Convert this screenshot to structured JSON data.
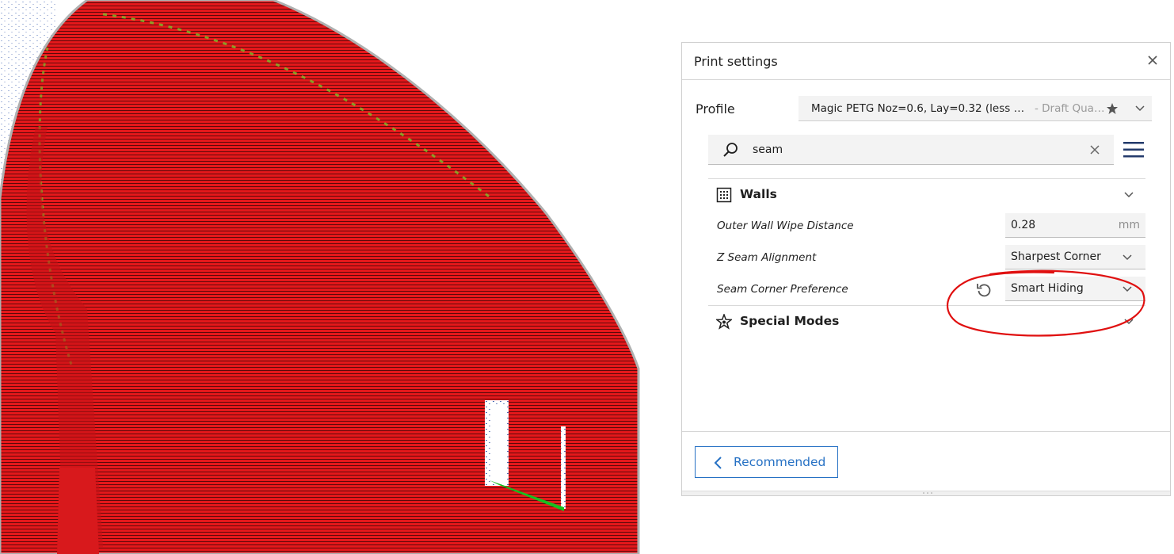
{
  "viewport": {
    "colors": {
      "model": "#e5181b",
      "layer_line": "#1a0000",
      "skin": "#7ec02a",
      "travel": "#4d6fb8",
      "background": "#ffffff"
    }
  },
  "print_settings": {
    "title": "Print settings",
    "profile": {
      "label": "Profile",
      "name": "Magic PETG Noz=0.6, Lay=0.32 (less w...",
      "quality": "- Draft Quality ..."
    },
    "search": {
      "value": "seam",
      "placeholder": ""
    },
    "categories": [
      {
        "label": "Walls",
        "icon": "walls-icon",
        "settings": [
          {
            "label": "Outer Wall Wipe Distance",
            "value": "0.28",
            "unit": "mm",
            "type": "number"
          },
          {
            "label": "Z Seam Alignment",
            "value": "Sharpest Corner",
            "type": "select"
          },
          {
            "label": "Seam Corner Preference",
            "value": "Smart Hiding",
            "type": "select",
            "modified": true
          }
        ]
      },
      {
        "label": "Special Modes",
        "icon": "special-modes-icon"
      }
    ],
    "footer": {
      "recommended_label": "Recommended"
    },
    "colors": {
      "accent": "#2671c4",
      "field_bg": "#f3f3f3",
      "annotation": "#e01010",
      "muted_text": "#9a9a9a"
    }
  }
}
